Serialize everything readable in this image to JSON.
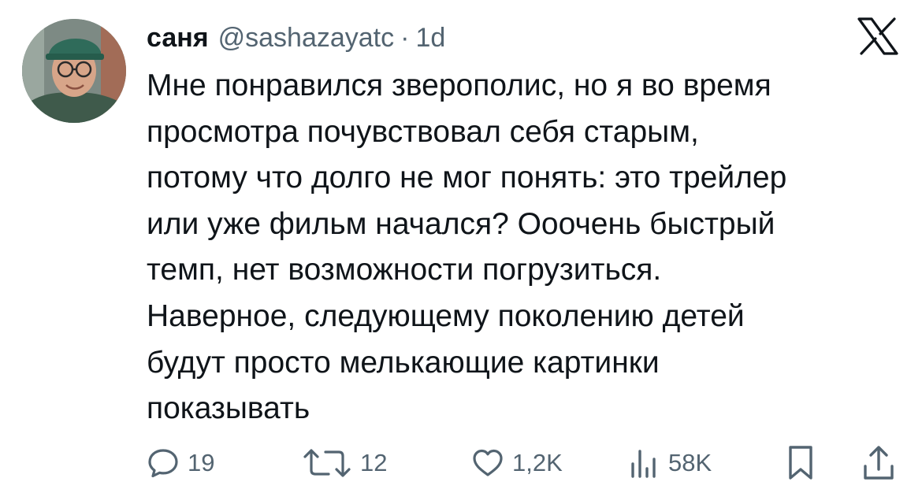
{
  "tweet": {
    "author": {
      "display_name": "саня",
      "handle": "@sashazayatc",
      "separator": "·",
      "time": "1d",
      "avatar_icon": "user-avatar-photo"
    },
    "platform_icon": "x-logo-icon",
    "text_lines": [
      "Мне понравился зверополис, но я во время",
      "просмотра почувствовал себя старым,",
      "потому что долго не мог понять: это трейлер",
      "или уже фильм начался? Ооочень быстрый",
      "темп, нет возможности погрузиться.",
      "Наверное, следующему поколению детей",
      "будут просто мелькающие картинки",
      "показывать"
    ],
    "actions": {
      "reply": {
        "icon": "reply-bubble-icon",
        "count": "19"
      },
      "retweet": {
        "icon": "retweet-icon",
        "count": "12"
      },
      "like": {
        "icon": "heart-icon",
        "count": "1,2K"
      },
      "views": {
        "icon": "views-bar-chart-icon",
        "count": "58K"
      },
      "bookmark": {
        "icon": "bookmark-icon"
      },
      "share": {
        "icon": "share-upload-icon"
      }
    },
    "colors": {
      "text_primary": "#0f1419",
      "text_secondary": "#536471",
      "background": "#ffffff"
    }
  }
}
